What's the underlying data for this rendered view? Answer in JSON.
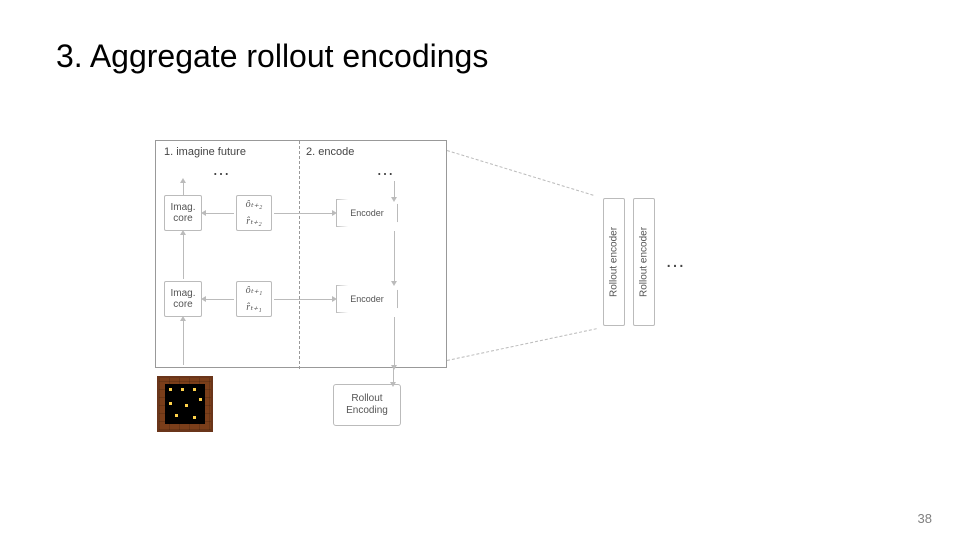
{
  "title": "3. Aggregate rollout encodings",
  "page_number": "38",
  "diagram": {
    "col_labels": {
      "left": "1. imagine future",
      "right": "2. encode"
    },
    "ellipsis": "…",
    "imag_core_label": "Imag. core",
    "encoder_label": "Encoder",
    "rollout_encoding_label": "Rollout Encoding",
    "rollout_encoder_label": "Rollout encoder",
    "state_symbols": {
      "o_hat_t2": "ôₜ₊₂",
      "r_hat_t2": "r̂ₜ₊₂",
      "o_hat_t1": "ôₜ₊₁",
      "r_hat_t1": "r̂ₜ₊₁"
    }
  }
}
